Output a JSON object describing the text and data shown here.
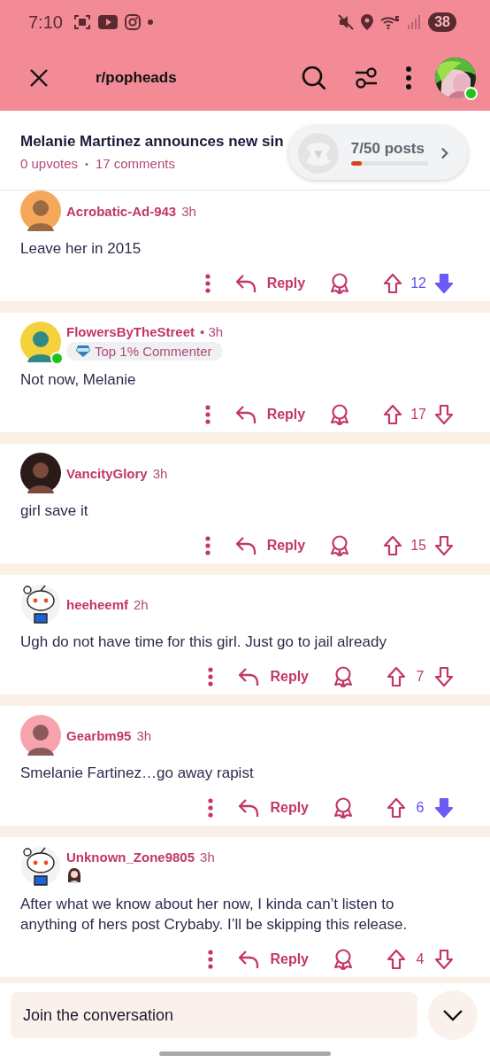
{
  "status_bar": {
    "time": "7:10",
    "battery": "38"
  },
  "app_bar": {
    "title": "r/popheads",
    "avatar_online": true
  },
  "post": {
    "title": "Melanie Martinez announces new sin",
    "upvotes": "0 upvotes",
    "separator": "•",
    "comments": "17 comments"
  },
  "progress_pill": {
    "label": "7/50 posts",
    "level": 0.14
  },
  "comments": [
    {
      "username": "Acrobatic-Ad-943",
      "time": "3h",
      "online": false,
      "text": "Leave her in 2015",
      "reply": "Reply",
      "score": "12",
      "downvoted": true
    },
    {
      "username": "FlowersByTheStreet",
      "time": "• 3h",
      "online": true,
      "flair": {
        "kind": "text",
        "label": "Top 1% Commenter"
      },
      "text": "Not now, Melanie",
      "reply": "Reply",
      "score": "17",
      "downvoted": false
    },
    {
      "username": "VancityGlory",
      "time": "3h",
      "online": false,
      "text": "girl save it",
      "reply": "Reply",
      "score": "15",
      "downvoted": false
    },
    {
      "username": "heeheemf",
      "time": "2h",
      "avatar": {
        "kind": "snoo"
      },
      "online": false,
      "text": "Ugh do not have time for this girl. Just go to jail already",
      "reply": "Reply",
      "score": "7",
      "downvoted": false
    },
    {
      "username": "Gearbm95",
      "time": "3h",
      "online": false,
      "text": "Smelanie Fartinez…go away rapist",
      "reply": "Reply",
      "score": "6",
      "downvoted": true
    },
    {
      "username": "Unknown_Zone9805",
      "time": "3h",
      "avatar": {
        "kind": "snoo"
      },
      "online": false,
      "text": "After what we know about her now, I kinda can’t listen to anything of hers post Crybaby. I’ll be skipping this release.",
      "reply": "Reply",
      "score": "4",
      "downvoted": false
    }
  ],
  "composer": {
    "placeholder": "Join the conversation"
  }
}
